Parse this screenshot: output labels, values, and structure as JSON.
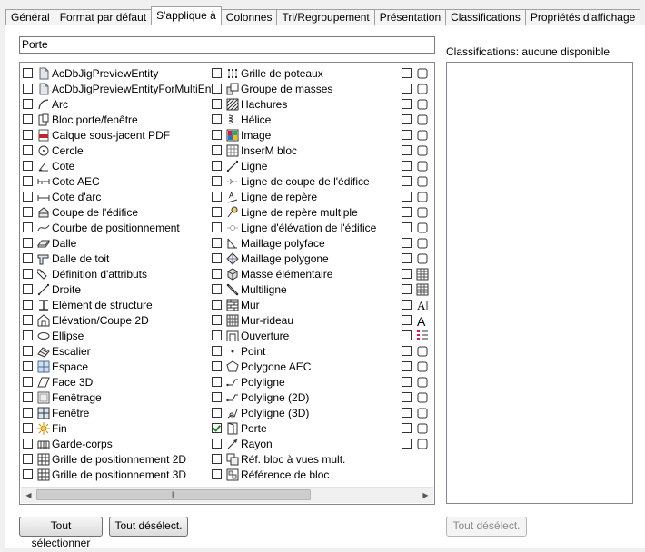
{
  "tabs": [
    "Général",
    "Format par défaut",
    "S'applique à",
    "Colonnes",
    "Tri/Regroupement",
    "Présentation",
    "Classifications",
    "Propriétés d'affichage"
  ],
  "active_tab": "S'applique à",
  "filter": {
    "value": "Porte"
  },
  "classifications_label": "Classifications: aucune disponible",
  "columns": [
    {
      "items": [
        {
          "label": "AcDbJigPreviewEntity",
          "icon": "doc-icon",
          "checked": false
        },
        {
          "label": "AcDbJigPreviewEntityForMultiEnts",
          "icon": "doc-icon",
          "checked": false
        },
        {
          "label": "Arc",
          "icon": "arc-icon",
          "checked": false
        },
        {
          "label": "Bloc porte/fenêtre",
          "icon": "door-window-icon",
          "checked": false
        },
        {
          "label": "Calque sous-jacent PDF",
          "icon": "pdf-icon",
          "checked": false
        },
        {
          "label": "Cercle",
          "icon": "circle-icon",
          "checked": false
        },
        {
          "label": "Cote",
          "icon": "dimension-icon",
          "checked": false
        },
        {
          "label": "Cote AEC",
          "icon": "aec-dimension-icon",
          "checked": false
        },
        {
          "label": "Cote d'arc",
          "icon": "arc-dimension-icon",
          "checked": false
        },
        {
          "label": "Coupe de l'édifice",
          "icon": "building-section-icon",
          "checked": false
        },
        {
          "label": "Courbe de positionnement",
          "icon": "curve-icon",
          "checked": false
        },
        {
          "label": "Dalle",
          "icon": "slab-icon",
          "checked": false
        },
        {
          "label": "Dalle de toit",
          "icon": "roof-slab-icon",
          "checked": false
        },
        {
          "label": "Définition d'attributs",
          "icon": "attribute-icon",
          "checked": false
        },
        {
          "label": "Droite",
          "icon": "line-icon",
          "checked": false
        },
        {
          "label": "Elément de structure",
          "icon": "structure-icon",
          "checked": false
        },
        {
          "label": "Elévation/Coupe 2D",
          "icon": "elevation-icon",
          "checked": false
        },
        {
          "label": "Ellipse",
          "icon": "ellipse-icon",
          "checked": false
        },
        {
          "label": "Escalier",
          "icon": "stair-icon",
          "checked": false
        },
        {
          "label": "Espace",
          "icon": "space-icon",
          "checked": false
        },
        {
          "label": "Face 3D",
          "icon": "face3d-icon",
          "checked": false
        },
        {
          "label": "Fenêtrage",
          "icon": "window-assembly-icon",
          "checked": false
        },
        {
          "label": "Fenêtre",
          "icon": "window-icon",
          "checked": false
        },
        {
          "label": "Fin",
          "icon": "sun-icon",
          "checked": false
        },
        {
          "label": "Garde-corps",
          "icon": "railing-icon",
          "checked": false
        },
        {
          "label": "Grille de positionnement 2D",
          "icon": "grid-icon",
          "checked": false
        },
        {
          "label": "Grille de positionnement 3D",
          "icon": "grid-icon",
          "checked": false
        }
      ]
    },
    {
      "items": [
        {
          "label": "Grille de poteaux",
          "icon": "column-grid-icon",
          "checked": false
        },
        {
          "label": "Groupe de masses",
          "icon": "mass-group-icon",
          "checked": false
        },
        {
          "label": "Hachures",
          "icon": "hatch-icon",
          "checked": false
        },
        {
          "label": "Hélice",
          "icon": "helix-icon",
          "checked": false
        },
        {
          "label": "Image",
          "icon": "image-icon",
          "checked": false
        },
        {
          "label": "InserM bloc",
          "icon": "block-icon",
          "checked": false
        },
        {
          "label": "Ligne",
          "icon": "line-icon",
          "checked": false
        },
        {
          "label": "Ligne de coupe de l'édifice",
          "icon": "section-line-icon",
          "checked": false
        },
        {
          "label": "Ligne de repère",
          "icon": "leader-icon",
          "checked": false
        },
        {
          "label": "Ligne de repère multiple",
          "icon": "multileader-icon",
          "checked": false
        },
        {
          "label": "Ligne d'élévation de l'édifice",
          "icon": "elevation-line-icon",
          "checked": false
        },
        {
          "label": "Maillage polyface",
          "icon": "mesh-icon",
          "checked": false
        },
        {
          "label": "Maillage polygone",
          "icon": "polygon-mesh-icon",
          "checked": false
        },
        {
          "label": "Masse élémentaire",
          "icon": "mass-icon",
          "checked": false
        },
        {
          "label": "Multiligne",
          "icon": "multiline-icon",
          "checked": false
        },
        {
          "label": "Mur",
          "icon": "wall-icon",
          "checked": false
        },
        {
          "label": "Mur-rideau",
          "icon": "curtain-wall-icon",
          "checked": false
        },
        {
          "label": "Ouverture",
          "icon": "opening-icon",
          "checked": false
        },
        {
          "label": "Point",
          "icon": "point-icon",
          "checked": false
        },
        {
          "label": "Polygone AEC",
          "icon": "polygon-icon",
          "checked": false
        },
        {
          "label": "Polyligne",
          "icon": "polyline-icon",
          "checked": false
        },
        {
          "label": "Polyligne (2D)",
          "icon": "polyline-icon",
          "checked": false
        },
        {
          "label": "Polyligne (3D)",
          "icon": "polyline3d-icon",
          "checked": false
        },
        {
          "label": "Porte",
          "icon": "door-icon",
          "checked": true
        },
        {
          "label": "Rayon",
          "icon": "ray-icon",
          "checked": false
        },
        {
          "label": "Réf. bloc à vues mult.",
          "icon": "multiview-block-icon",
          "checked": false
        },
        {
          "label": "Référence de bloc",
          "icon": "block-reference-icon",
          "checked": false
        }
      ]
    },
    {
      "items": [
        {
          "label": "",
          "icon": "shape-icon",
          "checked": false
        },
        {
          "label": "",
          "icon": "shape-icon",
          "checked": false
        },
        {
          "label": "",
          "icon": "shape-icon",
          "checked": false
        },
        {
          "label": "",
          "icon": "shape-icon",
          "checked": false
        },
        {
          "label": "",
          "icon": "shape-icon",
          "checked": false
        },
        {
          "label": "",
          "icon": "shape-icon",
          "checked": false
        },
        {
          "label": "",
          "icon": "shape-icon",
          "checked": false
        },
        {
          "label": "",
          "icon": "shape-icon",
          "checked": false
        },
        {
          "label": "",
          "icon": "shape-icon",
          "checked": false
        },
        {
          "label": "",
          "icon": "shape-icon",
          "checked": false
        },
        {
          "label": "",
          "icon": "shape-icon",
          "checked": false
        },
        {
          "label": "",
          "icon": "shape-icon",
          "checked": false
        },
        {
          "label": "",
          "icon": "shape-icon",
          "checked": false
        },
        {
          "label": "",
          "icon": "table-icon",
          "checked": false
        },
        {
          "label": "",
          "icon": "table-icon",
          "checked": false
        },
        {
          "label": "",
          "icon": "text-icon",
          "checked": false
        },
        {
          "label": "",
          "icon": "mtext-icon",
          "checked": false
        },
        {
          "label": "",
          "icon": "list-icon",
          "checked": false
        },
        {
          "label": "",
          "icon": "shape-icon",
          "checked": false
        },
        {
          "label": "",
          "icon": "shape-icon",
          "checked": false
        },
        {
          "label": "",
          "icon": "shape-icon",
          "checked": false
        },
        {
          "label": "",
          "icon": "shape-icon",
          "checked": false
        },
        {
          "label": "",
          "icon": "shape-icon",
          "checked": false
        },
        {
          "label": "",
          "icon": "shape-icon",
          "checked": false
        },
        {
          "label": "",
          "icon": "shape-icon",
          "checked": false
        }
      ]
    }
  ],
  "buttons": {
    "select_all": "Tout sélectionner",
    "deselect_all": "Tout désélect.",
    "class_deselect": "Tout désélect."
  }
}
